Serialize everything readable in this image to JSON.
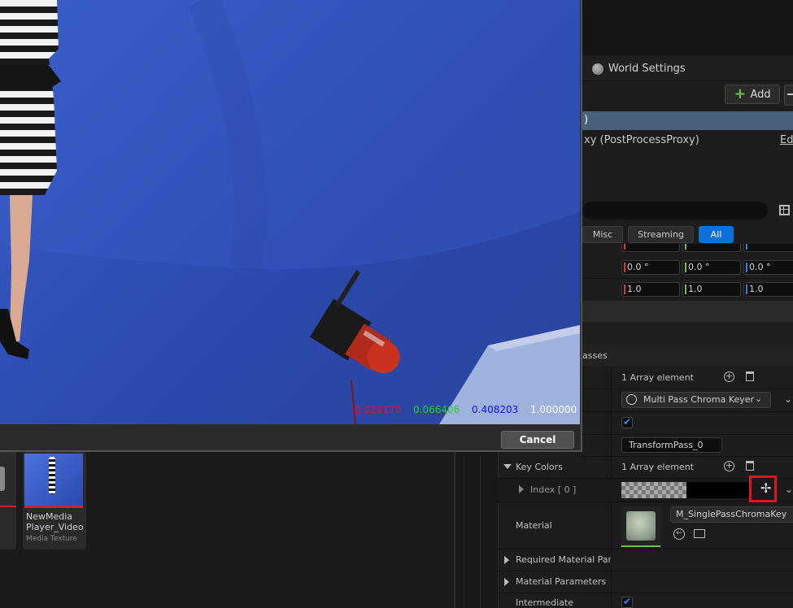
{
  "world_settings": {
    "tab_label": "World Settings"
  },
  "toolbar": {
    "add_label": "Add"
  },
  "outliner": {
    "selected_suffix": ")",
    "proxy_row": "xy (PostProcessProxy)",
    "edit_link": "Edi"
  },
  "filters": {
    "misc": "Misc",
    "streaming": "Streaming",
    "all": "All"
  },
  "transform": {
    "rotation": [
      "0.0 °",
      "0.0 °",
      "0.0 °"
    ],
    "scale": [
      "1.0",
      "1.0",
      "1.0"
    ]
  },
  "properties": {
    "passes_label": "asses",
    "passes_value": "1 Array element",
    "keyer_value": "Multi Pass Chroma Keyer",
    "transform_pass_value": "TransformPass_0",
    "key_colors_label": "Key Colors",
    "key_colors_value": "1 Array element",
    "index_label": "Index [ 0 ]",
    "material_label": "Material",
    "material_value": "M_SinglePassChromaKey",
    "required_params_label": "Required Material Para",
    "material_params_label": "Material Parameters",
    "intermediate_label": "Intermediate"
  },
  "color_picker": {
    "r": "0.024170",
    "g": "0.066406",
    "b": "0.408203",
    "a": "1.000000",
    "cancel_label": "Cancel"
  },
  "content_browser": {
    "asset_name": "NewMedia Player_Video",
    "asset_type": "Media Texture"
  },
  "colors": {
    "accent_blue": "#0f6fd8",
    "selection": "#4b607b",
    "highlight_red": "#e0141e"
  }
}
